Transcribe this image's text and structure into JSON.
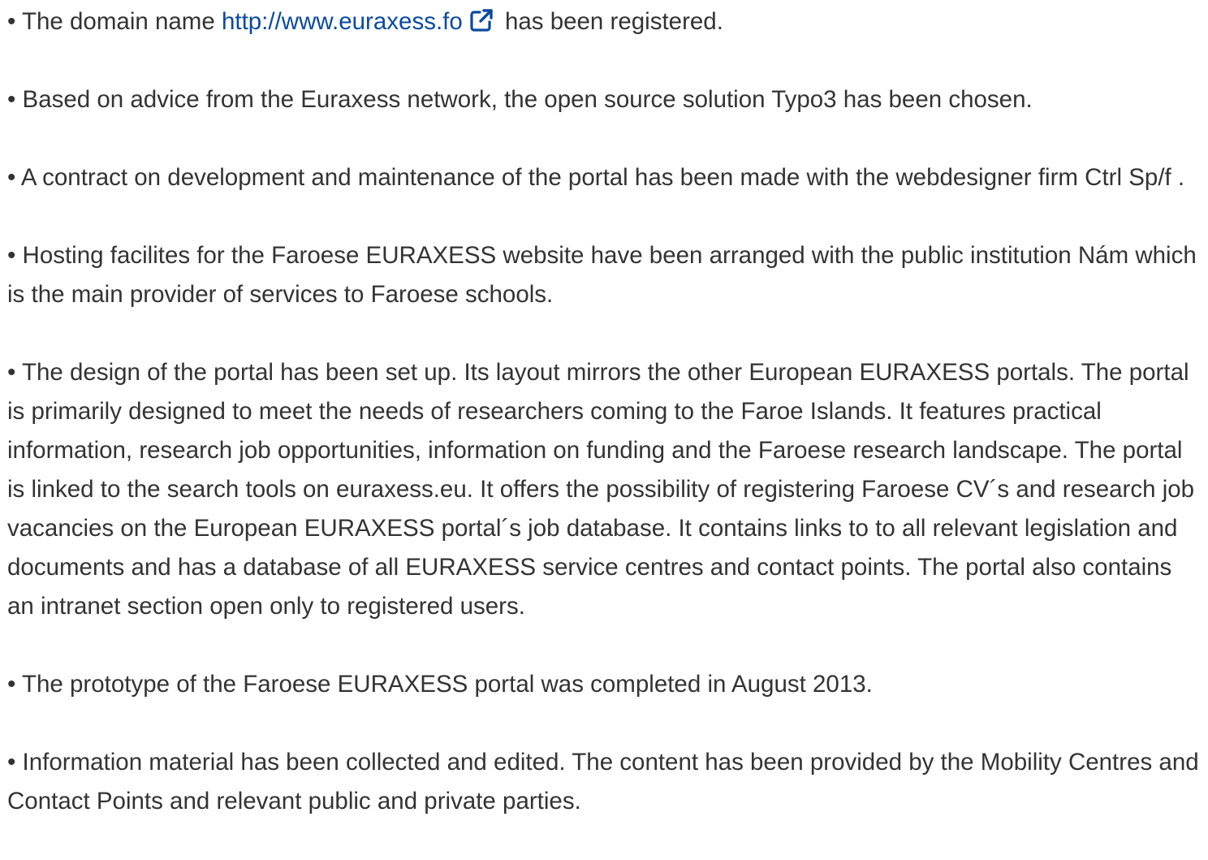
{
  "colors": {
    "text": "#333333",
    "link": "#0a4a9e",
    "background": "#ffffff"
  },
  "items": [
    {
      "prefix": "• The domain name ",
      "link_text": "http://www.euraxess.fo",
      "link_icon": "external-link-icon",
      "suffix": " has been registered."
    },
    {
      "text": "• Based on advice from the Euraxess network, the open source solution Typo3 has been chosen."
    },
    {
      "text": "• A contract on development and maintenance of the portal has been made with the webdesigner firm Ctrl Sp/f ."
    },
    {
      "text": "• Hosting facilites for the Faroese EURAXESS website have been arranged with the public institution Nám which is the main provider of services to Faroese schools."
    },
    {
      "text": "• The design of the portal has been set up. Its layout mirrors the other European EURAXESS portals. The portal is primarily designed to meet the needs of researchers coming to the Faroe Islands. It features practical information, research job opportunities, information on funding and the Faroese research landscape. The portal is linked to the search tools on euraxess.eu. It offers the possibility of registering Faroese CV´s and research job vacancies on the European EURAXESS portal´s job database. It contains links to to all relevant legislation and documents and has a database of all EURAXESS service centres and contact points. The portal also contains an intranet section open only to registered users."
    },
    {
      "text": "• The prototype of the Faroese EURAXESS portal was completed in August 2013."
    },
    {
      "text": "• Information material has been collected and edited. The content has been provided by the Mobility Centres and Contact Points and relevant public and private parties."
    }
  ]
}
